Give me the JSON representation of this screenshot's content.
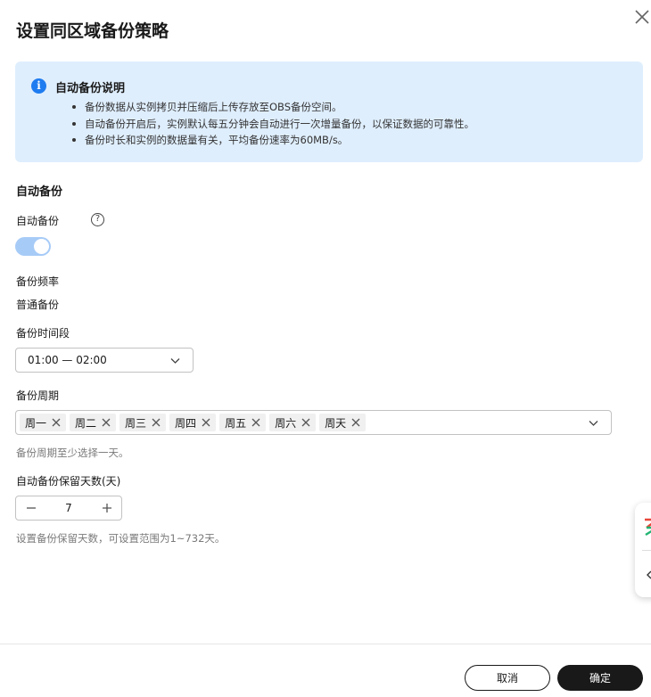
{
  "dialog": {
    "title": "设置同区域备份策略"
  },
  "info": {
    "title": "自动备份说明",
    "items": [
      "备份数据从实例拷贝并压缩后上传存放至OBS备份空间。",
      "自动备份开启后，实例默认每五分钟会自动进行一次增量备份，以保证数据的可靠性。",
      "备份时长和实例的数据量有关，平均备份速率为60MB/s。"
    ]
  },
  "form": {
    "section_title": "自动备份",
    "auto_backup_label": "自动备份",
    "auto_backup_enabled": true,
    "frequency_label": "备份频率",
    "frequency_value": "普通备份",
    "time_window_label": "备份时间段",
    "time_window_value": "01:00 — 02:00",
    "cycle_label": "备份周期",
    "cycle_days": [
      "周一",
      "周二",
      "周三",
      "周四",
      "周五",
      "周六",
      "周天"
    ],
    "cycle_hint": "备份周期至少选择一天。",
    "retention_label": "自动备份保留天数(天)",
    "retention_value": "7",
    "retention_hint": "设置备份保留天数，可设置范围为1~732天。"
  },
  "footer": {
    "cancel_label": "取消",
    "ok_label": "确定"
  },
  "colors": {
    "info_bg": "#dfeefd",
    "info_icon": "#1f7cf0",
    "toggle_on": "#a7cbf7",
    "primary_button": "#191919"
  }
}
